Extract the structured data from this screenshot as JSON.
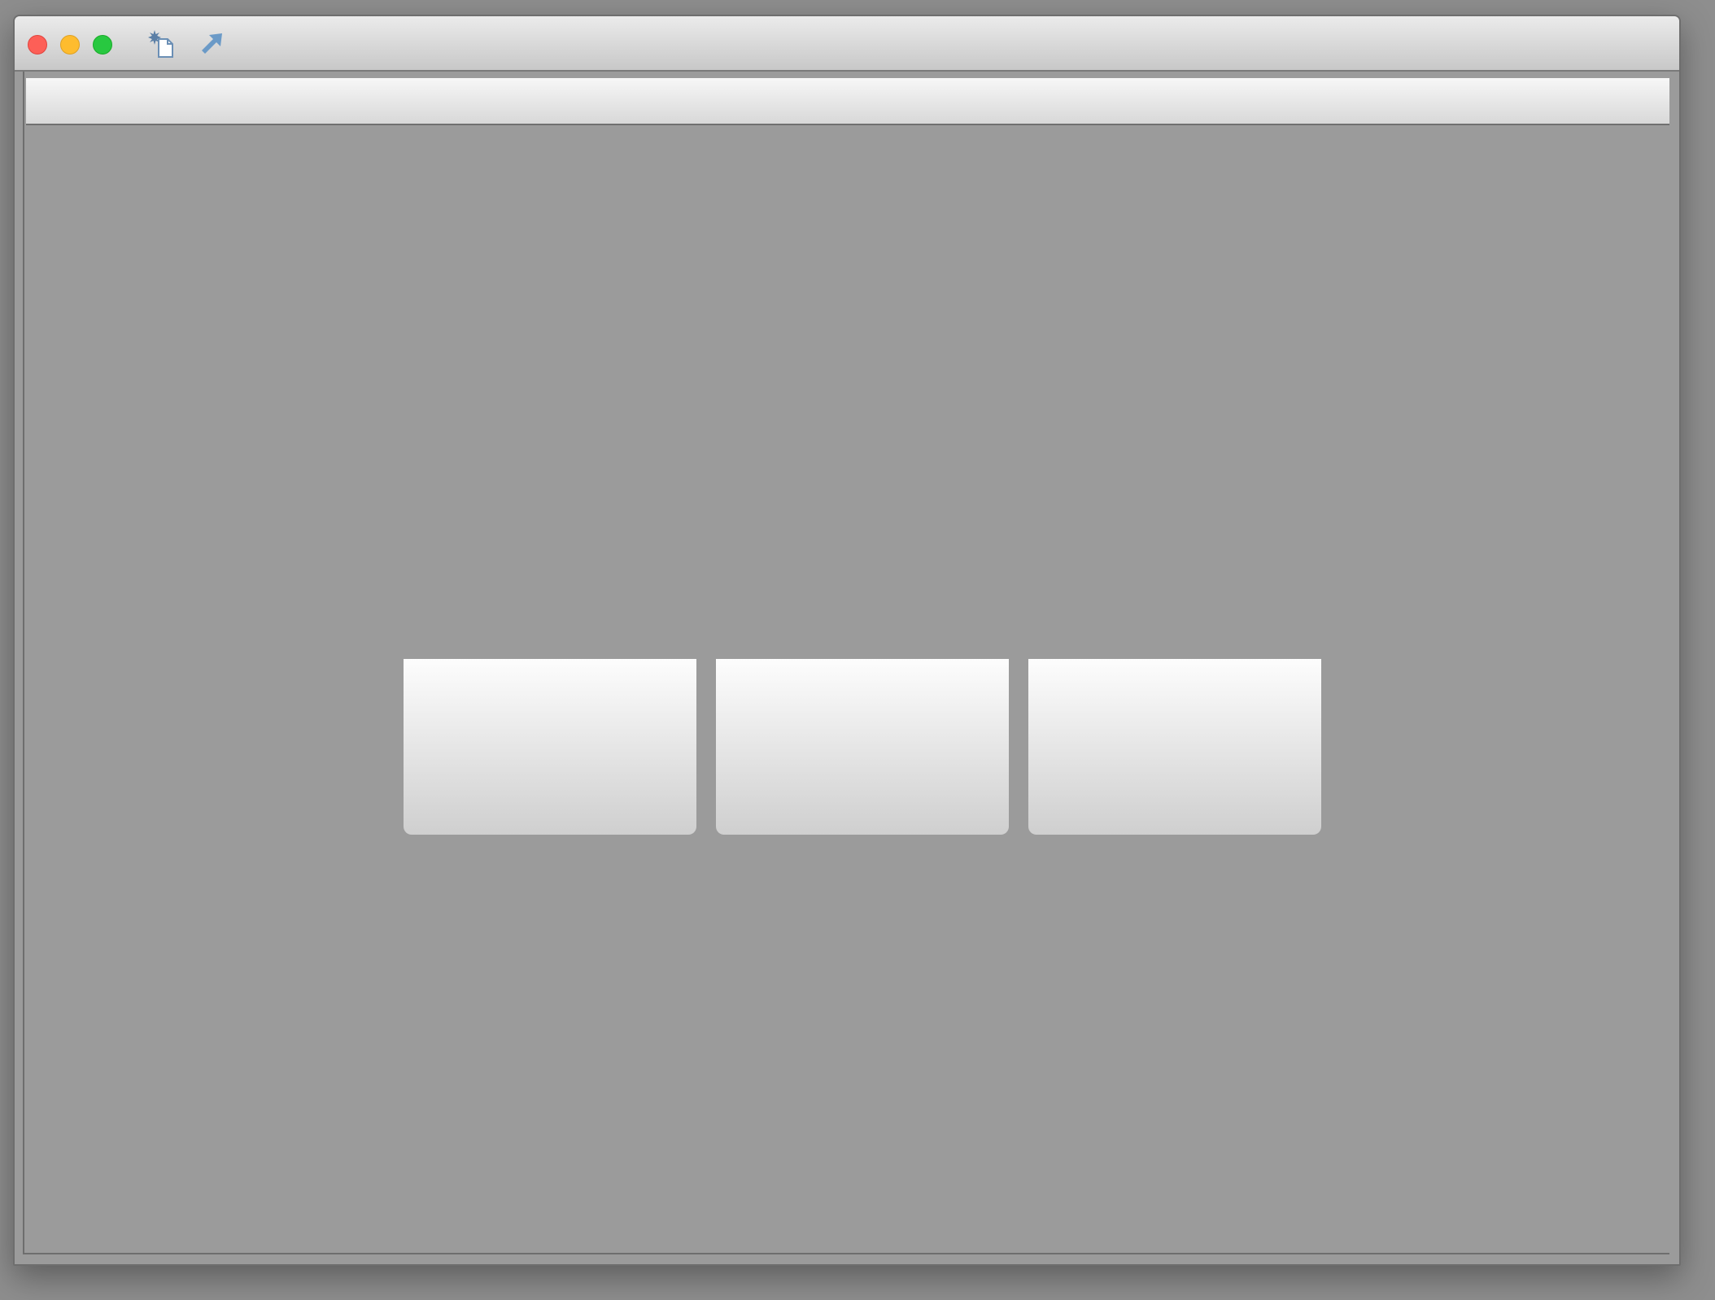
{
  "window": {
    "title": "",
    "controls": [
      "close",
      "minimize",
      "maximize"
    ]
  },
  "toolbar": {
    "icons": [
      "new-document-icon",
      "share-arrow-icon"
    ],
    "accent_color": "#6b9ac7"
  },
  "panels": [
    "",
    "",
    ""
  ],
  "colors": {
    "close": "#fd5f57",
    "minimize": "#febc2e",
    "maximize": "#28c840",
    "canvas": "#9b9b9b"
  }
}
